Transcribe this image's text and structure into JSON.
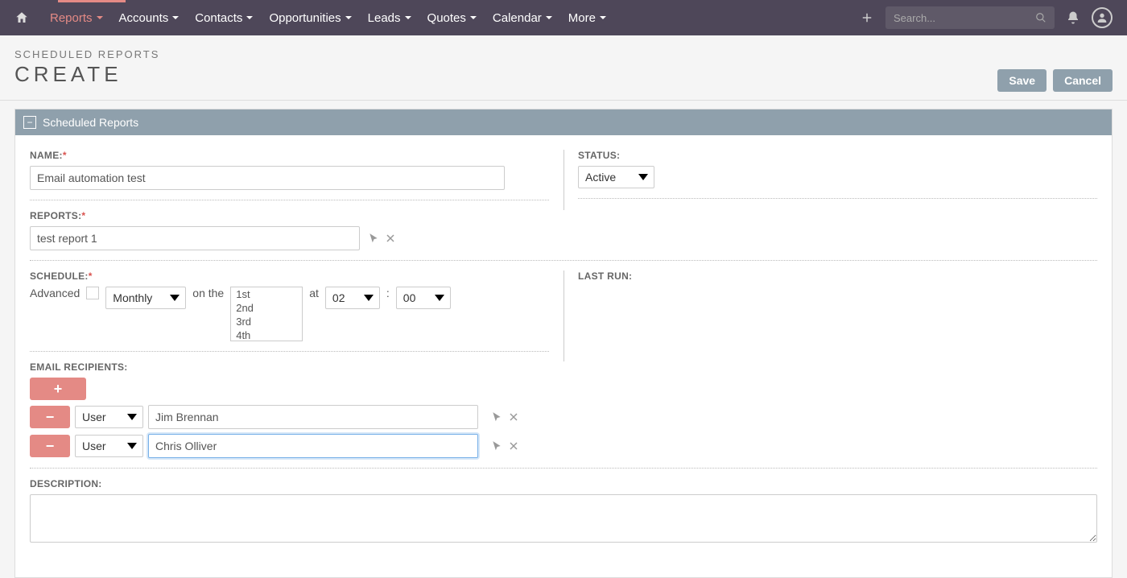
{
  "nav": {
    "items": [
      "Reports",
      "Accounts",
      "Contacts",
      "Opportunities",
      "Leads",
      "Quotes",
      "Calendar",
      "More"
    ],
    "active_index": 0,
    "search_placeholder": "Search..."
  },
  "header": {
    "breadcrumb": "SCHEDULED REPORTS",
    "title": "CREATE",
    "save_label": "Save",
    "cancel_label": "Cancel"
  },
  "panel": {
    "title": "Scheduled Reports"
  },
  "form": {
    "name_label": "NAME:",
    "name_value": "Email automation test",
    "status_label": "STATUS:",
    "status_value": "Active",
    "reports_label": "REPORTS:",
    "reports_value": "test report 1",
    "schedule_label": "SCHEDULE:",
    "advanced_label": "Advanced",
    "frequency_value": "Monthly",
    "on_the_label": "on the",
    "day_options": [
      "1st",
      "2nd",
      "3rd",
      "4th"
    ],
    "at_label": "at",
    "hour_value": "02",
    "colon": ":",
    "minute_value": "00",
    "last_run_label": "LAST RUN:",
    "recipients_label": "EMAIL RECIPIENTS:",
    "recipients": [
      {
        "type": "User",
        "name": "Jim Brennan",
        "focused": false
      },
      {
        "type": "User",
        "name": "Chris Olliver",
        "focused": true
      }
    ],
    "description_label": "DESCRIPTION:",
    "description_value": ""
  },
  "icons": {
    "plus": "+",
    "minus": "−",
    "pointer": "➤",
    "close": "✕",
    "collapse": "−"
  }
}
